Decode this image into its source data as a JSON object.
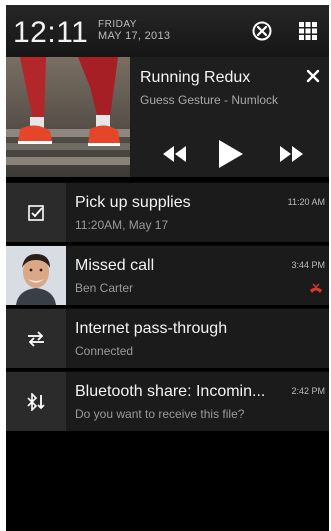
{
  "status_bar": {
    "time": "12:11",
    "day": "FRIDAY",
    "date": "MAY 17, 2013",
    "settings_icon": "settings-icon",
    "apps_icon": "apps-grid-icon"
  },
  "media": {
    "title": "Running Redux",
    "artist": "Guess Gesture - Numlock",
    "close_icon": "close-icon",
    "controls": [
      "previous-icon",
      "play-icon",
      "next-icon"
    ]
  },
  "notifications": [
    {
      "icon": "task-check-icon",
      "title": "Pick up supplies",
      "subtitle": "11:20AM, May 17",
      "time": "11:20 AM"
    },
    {
      "icon": "contact-photo",
      "title": "Missed call",
      "subtitle": "Ben Carter",
      "time": "3:44 PM",
      "status_icon": "missed-call-icon",
      "status_color": "#d8392b"
    },
    {
      "icon": "pass-through-icon",
      "title": "Internet pass-through",
      "subtitle": "Connected",
      "time": ""
    },
    {
      "icon": "bluetooth-icon",
      "title": "Bluetooth share: Incomin...",
      "subtitle": "Do you want to receive this file?",
      "time": "2:42 PM"
    }
  ],
  "colors": {
    "panel": "#1b1b1b",
    "icon_box": "#2b2b2b",
    "background": "#000000"
  }
}
